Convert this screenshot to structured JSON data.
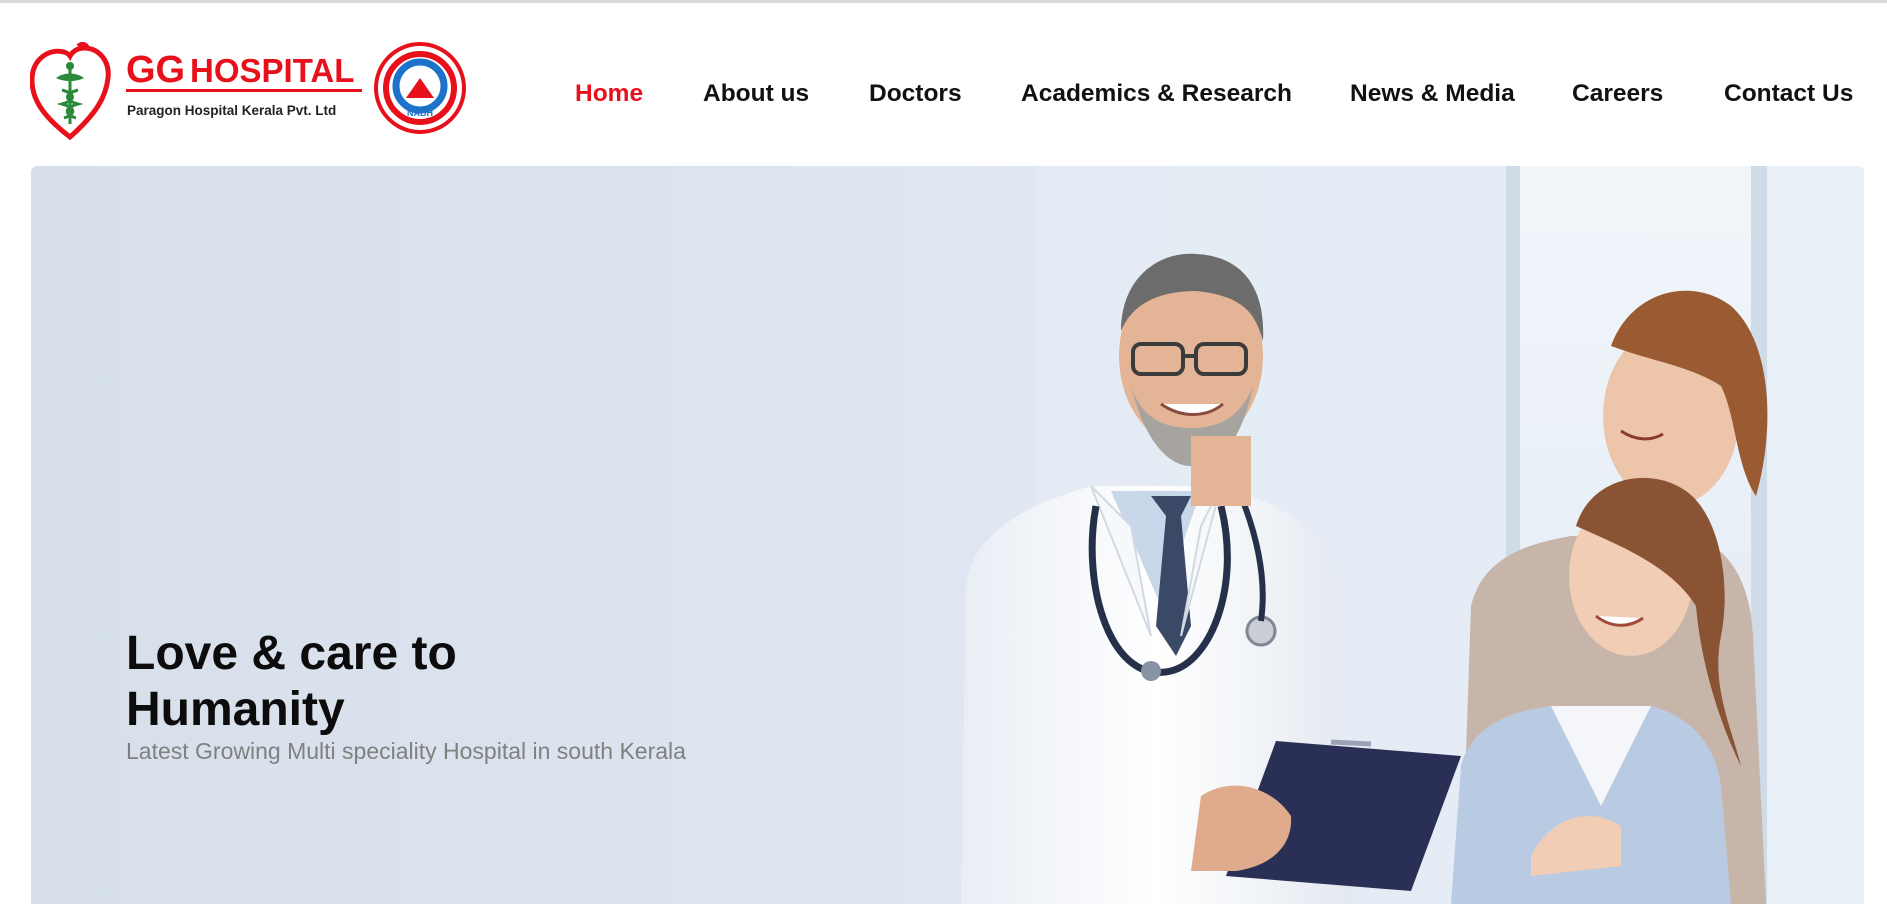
{
  "header": {
    "logo": {
      "brand_gg": "GG",
      "brand_hospital": "HOSPITAL",
      "tagline": "Paragon Hospital Kerala Pvt. Ltd",
      "badge_text": "NABH"
    },
    "nav": [
      {
        "label": "Home",
        "active": true
      },
      {
        "label": "About us",
        "active": false
      },
      {
        "label": "Doctors",
        "active": false
      },
      {
        "label": "Academics & Research",
        "active": false
      },
      {
        "label": "News & Media",
        "active": false
      },
      {
        "label": "Careers",
        "active": false
      },
      {
        "label": "Contact Us",
        "active": false
      }
    ]
  },
  "hero": {
    "title": "Love & care to Humanity",
    "subtitle": "Latest Growing Multi speciality Hospital in south Kerala"
  },
  "colors": {
    "accent_red": "#e8101b",
    "nav_text": "#111111",
    "badge_blue": "#1d72c9",
    "hero_background": "#dbe3ee"
  }
}
